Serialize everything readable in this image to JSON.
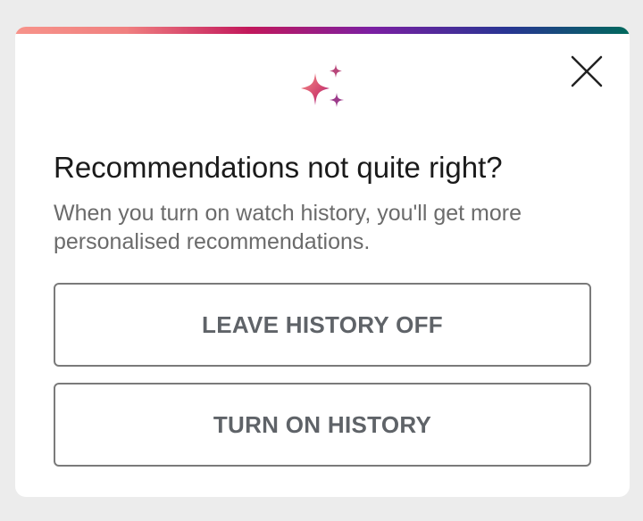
{
  "dialog": {
    "title": "Recommendations not quite right?",
    "description": "When you turn on watch history, you'll get more personalised recommendations.",
    "icon": "sparkle-icon",
    "close_icon": "close-icon"
  },
  "buttons": {
    "leave_history_off": "LEAVE HISTORY OFF",
    "turn_on_history": "TURN ON HISTORY"
  },
  "colors": {
    "gradient": [
      "#f7938a",
      "#c2185b",
      "#7b1fa2",
      "#1a237e",
      "#00695c"
    ],
    "sparkle": [
      "#f48a8a",
      "#c2185b",
      "#8e24aa"
    ],
    "title_text": "#1a1a1a",
    "body_text": "#6b6b6b",
    "button_text": "#5f6368",
    "button_border": "#7a7a7a",
    "background": "#ececec"
  }
}
